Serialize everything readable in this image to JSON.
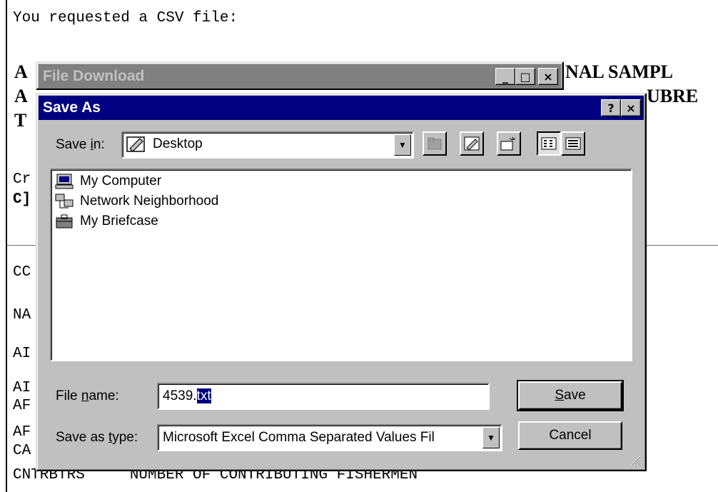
{
  "background_page": {
    "line1": "You requested a CSV file:",
    "bold_lines": [
      "A",
      "A",
      "T"
    ],
    "bold_right_1": "NAL SAMPL",
    "bold_right_2": "UBRE",
    "left_fragments": [
      "Cr",
      "C]",
      "CC",
      "NA",
      "AI",
      "AI",
      "AF",
      "AF",
      "CA"
    ],
    "last_line": "CNTRBTRS     NUMBER OF CONTRIBUTING FISHERMEN"
  },
  "file_download_window": {
    "title": "File Download",
    "buttons": {
      "minimize": "_",
      "maximize": "□",
      "close": "×"
    }
  },
  "save_as_dialog": {
    "title": "Save As",
    "help_button": "?",
    "close_button": "×",
    "save_in_label_pre": "Save ",
    "save_in_label_u": "i",
    "save_in_label_post": "n:",
    "save_in_value": "Desktop",
    "files": [
      {
        "name": "My Computer",
        "icon": "computer-icon"
      },
      {
        "name": "Network Neighborhood",
        "icon": "network-icon"
      },
      {
        "name": "My Briefcase",
        "icon": "briefcase-icon"
      }
    ],
    "file_name_label_pre": "File ",
    "file_name_label_u": "n",
    "file_name_label_post": "ame:",
    "file_name_base": "4539.",
    "file_name_selected": "txt",
    "save_as_type_label_pre": "Save as ",
    "save_as_type_label_u": "t",
    "save_as_type_label_post": "ype:",
    "save_as_type_value": "Microsoft Excel Comma Separated Values Fil",
    "save_button_u": "S",
    "save_button_rest": "ave",
    "cancel_button": "Cancel"
  },
  "colors": {
    "active_title": "#000080",
    "inactive_title": "#808080",
    "face": "#c0c0c0"
  }
}
